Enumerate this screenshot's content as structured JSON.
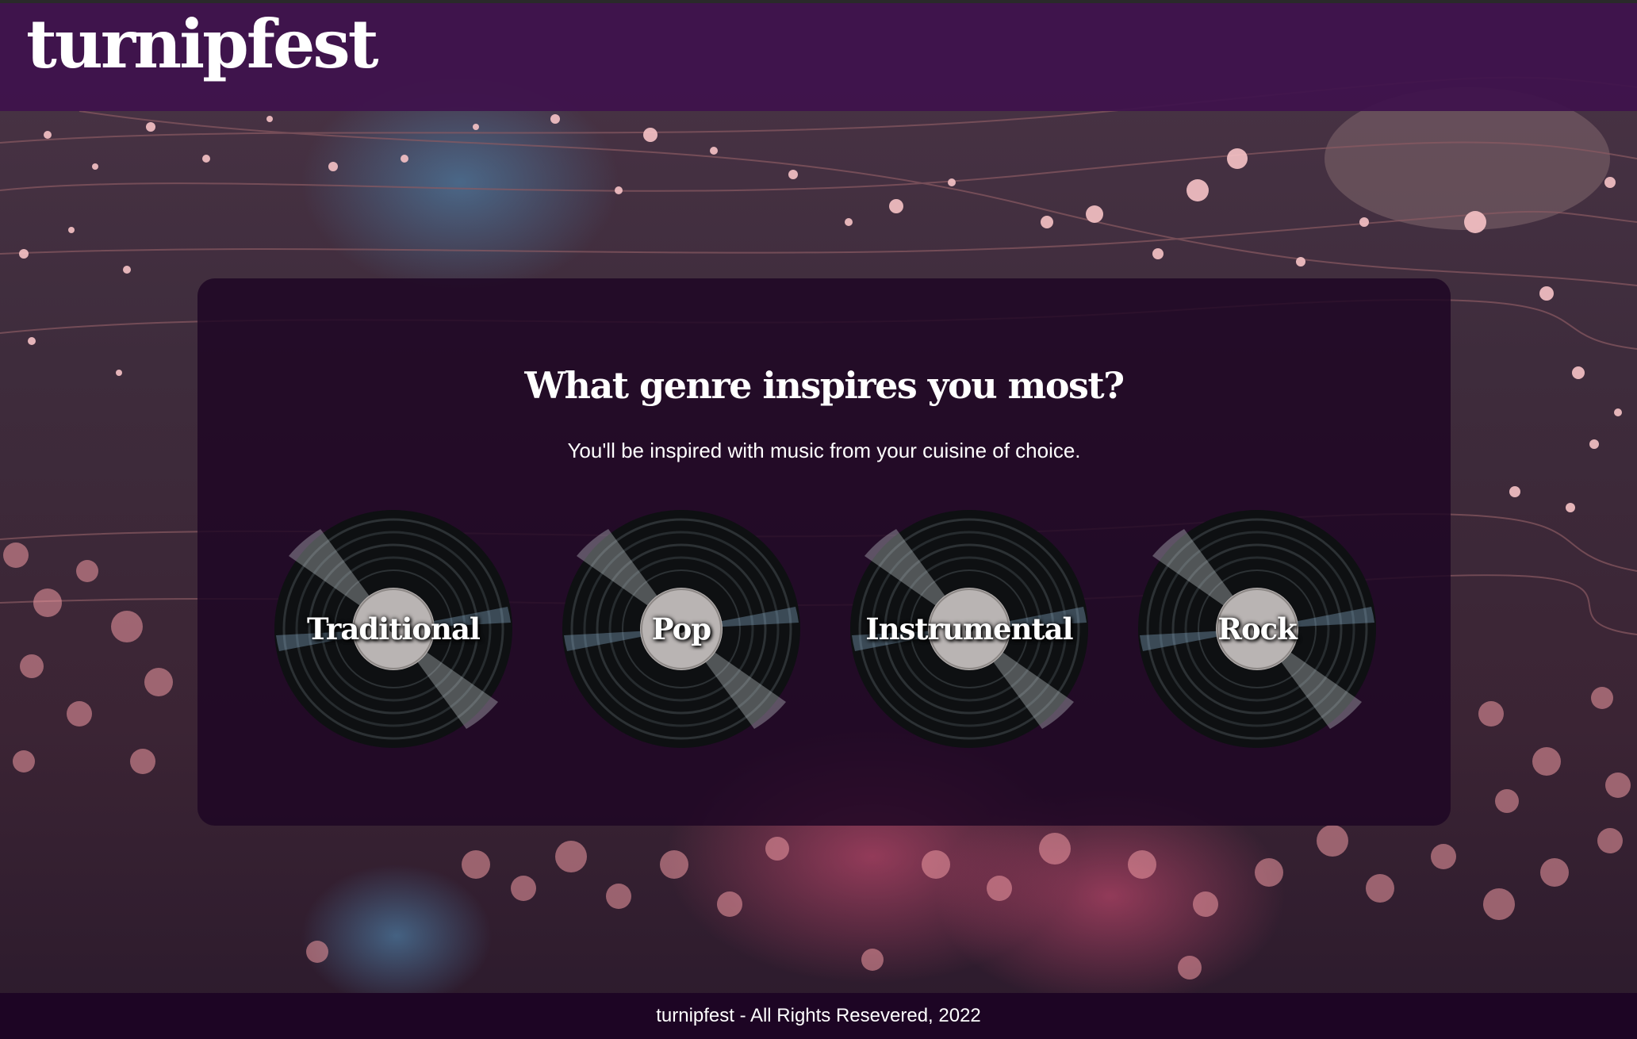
{
  "header": {
    "logo": "turnipfest"
  },
  "card": {
    "title": "What genre inspires you most?",
    "subtitle": "You'll be inspired with music from your cuisine of choice."
  },
  "genres": [
    {
      "label": "Traditional"
    },
    {
      "label": "Pop"
    },
    {
      "label": "Instrumental"
    },
    {
      "label": "Rock"
    }
  ],
  "footer": {
    "text": "turnipfest - All Rights Resevered, 2022"
  },
  "colors": {
    "header_bg": "#3e124c",
    "card_bg": "#1e0624",
    "footer_bg": "#1d0524",
    "text": "#ffffff",
    "bokeh": "#f3a3a9"
  }
}
